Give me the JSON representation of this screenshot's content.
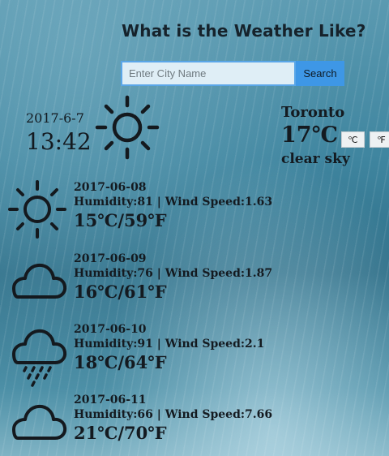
{
  "header": {
    "title": "What is the Weather Like?"
  },
  "search": {
    "placeholder": "Enter City Name",
    "value": "",
    "button_label": "Search"
  },
  "current": {
    "date": "2017-6-7",
    "time": "13:42",
    "icon": "sun-icon",
    "city": "Toronto",
    "temp": "17℃",
    "unit_c_label": "℃",
    "unit_f_label": "℉",
    "description": "clear sky"
  },
  "forecast": [
    {
      "date": "2017-06-08",
      "meta": "Humidity:81 | Wind Speed:1.63",
      "temp": "15℃/59℉",
      "icon": "sun-icon"
    },
    {
      "date": "2017-06-09",
      "meta": "Humidity:76 | Wind Speed:1.87",
      "temp": "16℃/61℉",
      "icon": "cloud-icon"
    },
    {
      "date": "2017-06-10",
      "meta": "Humidity:91 | Wind Speed:2.1",
      "temp": "18℃/64℉",
      "icon": "rain-cloud-icon"
    },
    {
      "date": "2017-06-11",
      "meta": "Humidity:66 | Wind Speed:7.66",
      "temp": "21℃/70℉",
      "icon": "cloud-icon"
    }
  ]
}
